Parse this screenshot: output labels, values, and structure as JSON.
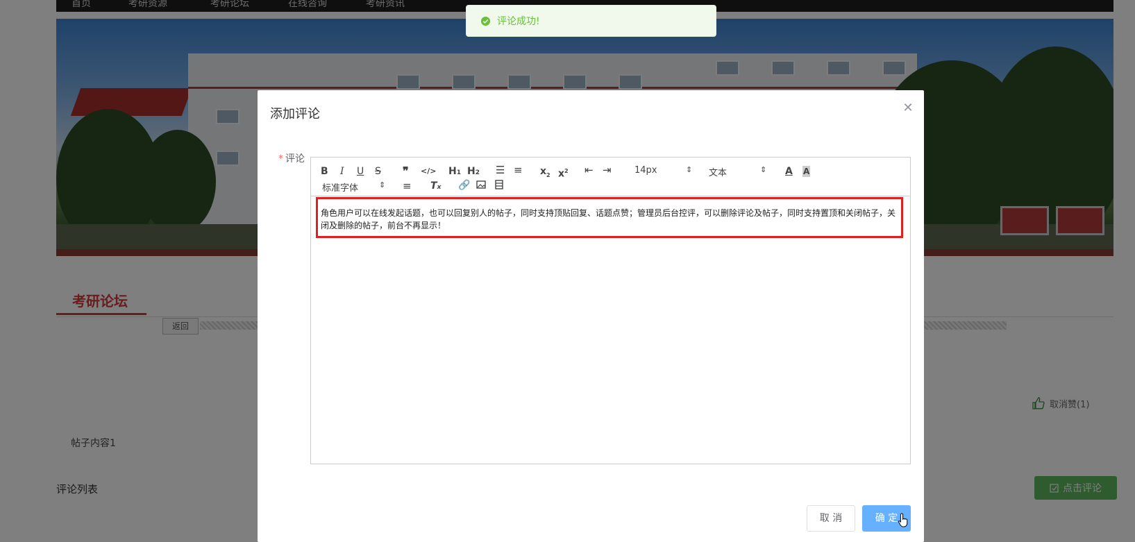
{
  "nav": {
    "items": [
      "首页",
      "考研资源",
      "考研论坛",
      "在线咨询",
      "考研资讯"
    ]
  },
  "forum": {
    "tab_title": "考研论坛",
    "back_label": "返回",
    "like_label": "取消赞(1)",
    "post_content": "帖子内容1",
    "comment_list_title": "评论列表",
    "click_comment_label": "点击评论"
  },
  "toast": {
    "message": "评论成功!",
    "icon": "check-circle-icon",
    "color": "#67c23a"
  },
  "modal": {
    "title": "添加评论",
    "field_label": "评论",
    "required_mark": "*",
    "editor": {
      "font_size": "14px",
      "heading": "文本",
      "font_family": "标准字体",
      "content": "角色用户可以在线发起话题，也可以回复别人的帖子，同时支持顶贴回复、话题点赞；管理员后台控评，可以删除评论及帖子，同时支持置顶和关闭帖子，关闭及删除的帖子，前台不再显示！"
    },
    "cancel_label": "取 消",
    "ok_label": "确 定"
  },
  "colors": {
    "accent": "#d23a3a",
    "primary": "#66b1ff",
    "success": "#67c23a",
    "highlight": "#e02020"
  }
}
